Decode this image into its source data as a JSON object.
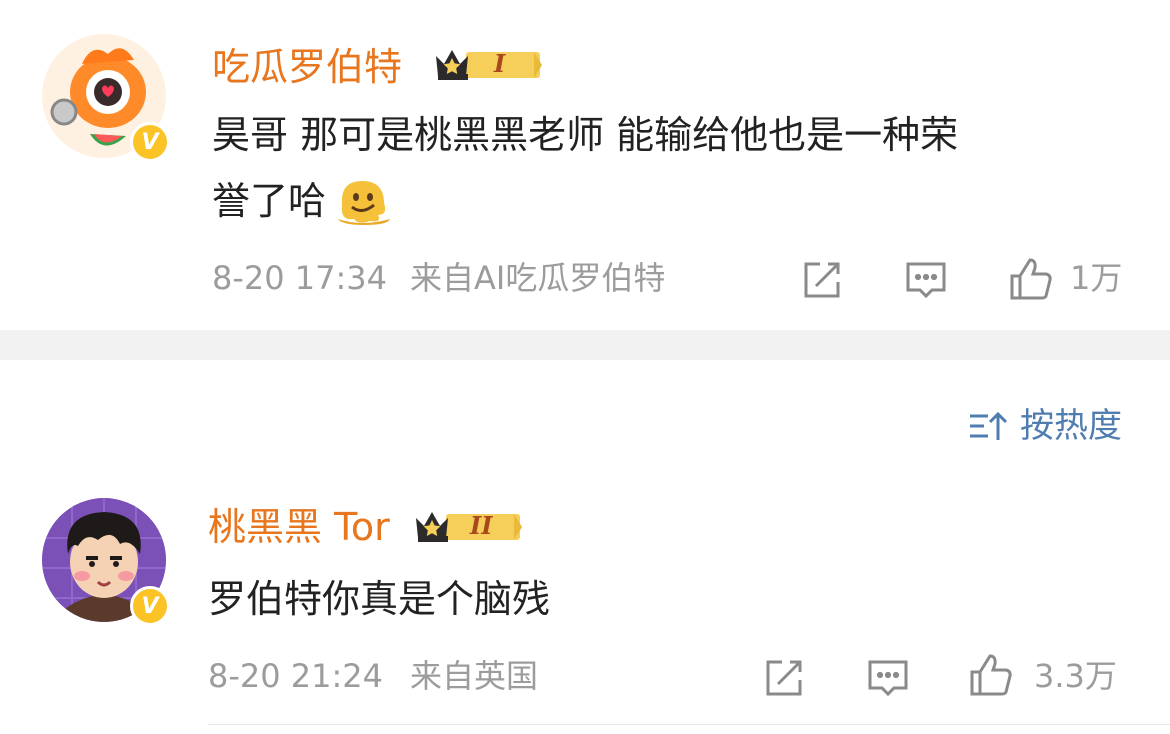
{
  "comments": [
    {
      "username": "吃瓜罗伯特",
      "level_badge": "I",
      "text_line1": "昊哥 那可是桃黑黑老师 能输给他也是一种荣",
      "text_line2": "誉了哈",
      "emoji": "melting-face-emoji",
      "time": "8-20 17:34",
      "source": "来自AI吃瓜罗伯特",
      "likes": "1万"
    },
    {
      "username": "桃黑黑 Tor",
      "level_badge": "II",
      "text_line1": "罗伯特你真是个脑残",
      "time": "8-20 21:24",
      "source": "来自英国",
      "likes": "3.3万"
    }
  ],
  "sort": {
    "label": "按热度",
    "icon": "sort-icon"
  },
  "icons": [
    "share-icon",
    "comment-icon",
    "like-icon",
    "verified-v-icon",
    "crown-icon"
  ],
  "colors": {
    "username": "#e8761f",
    "meta": "#9c9c9c",
    "sort": "#507daf",
    "divider": "#f2f2f2",
    "verified": "#fbc325"
  }
}
